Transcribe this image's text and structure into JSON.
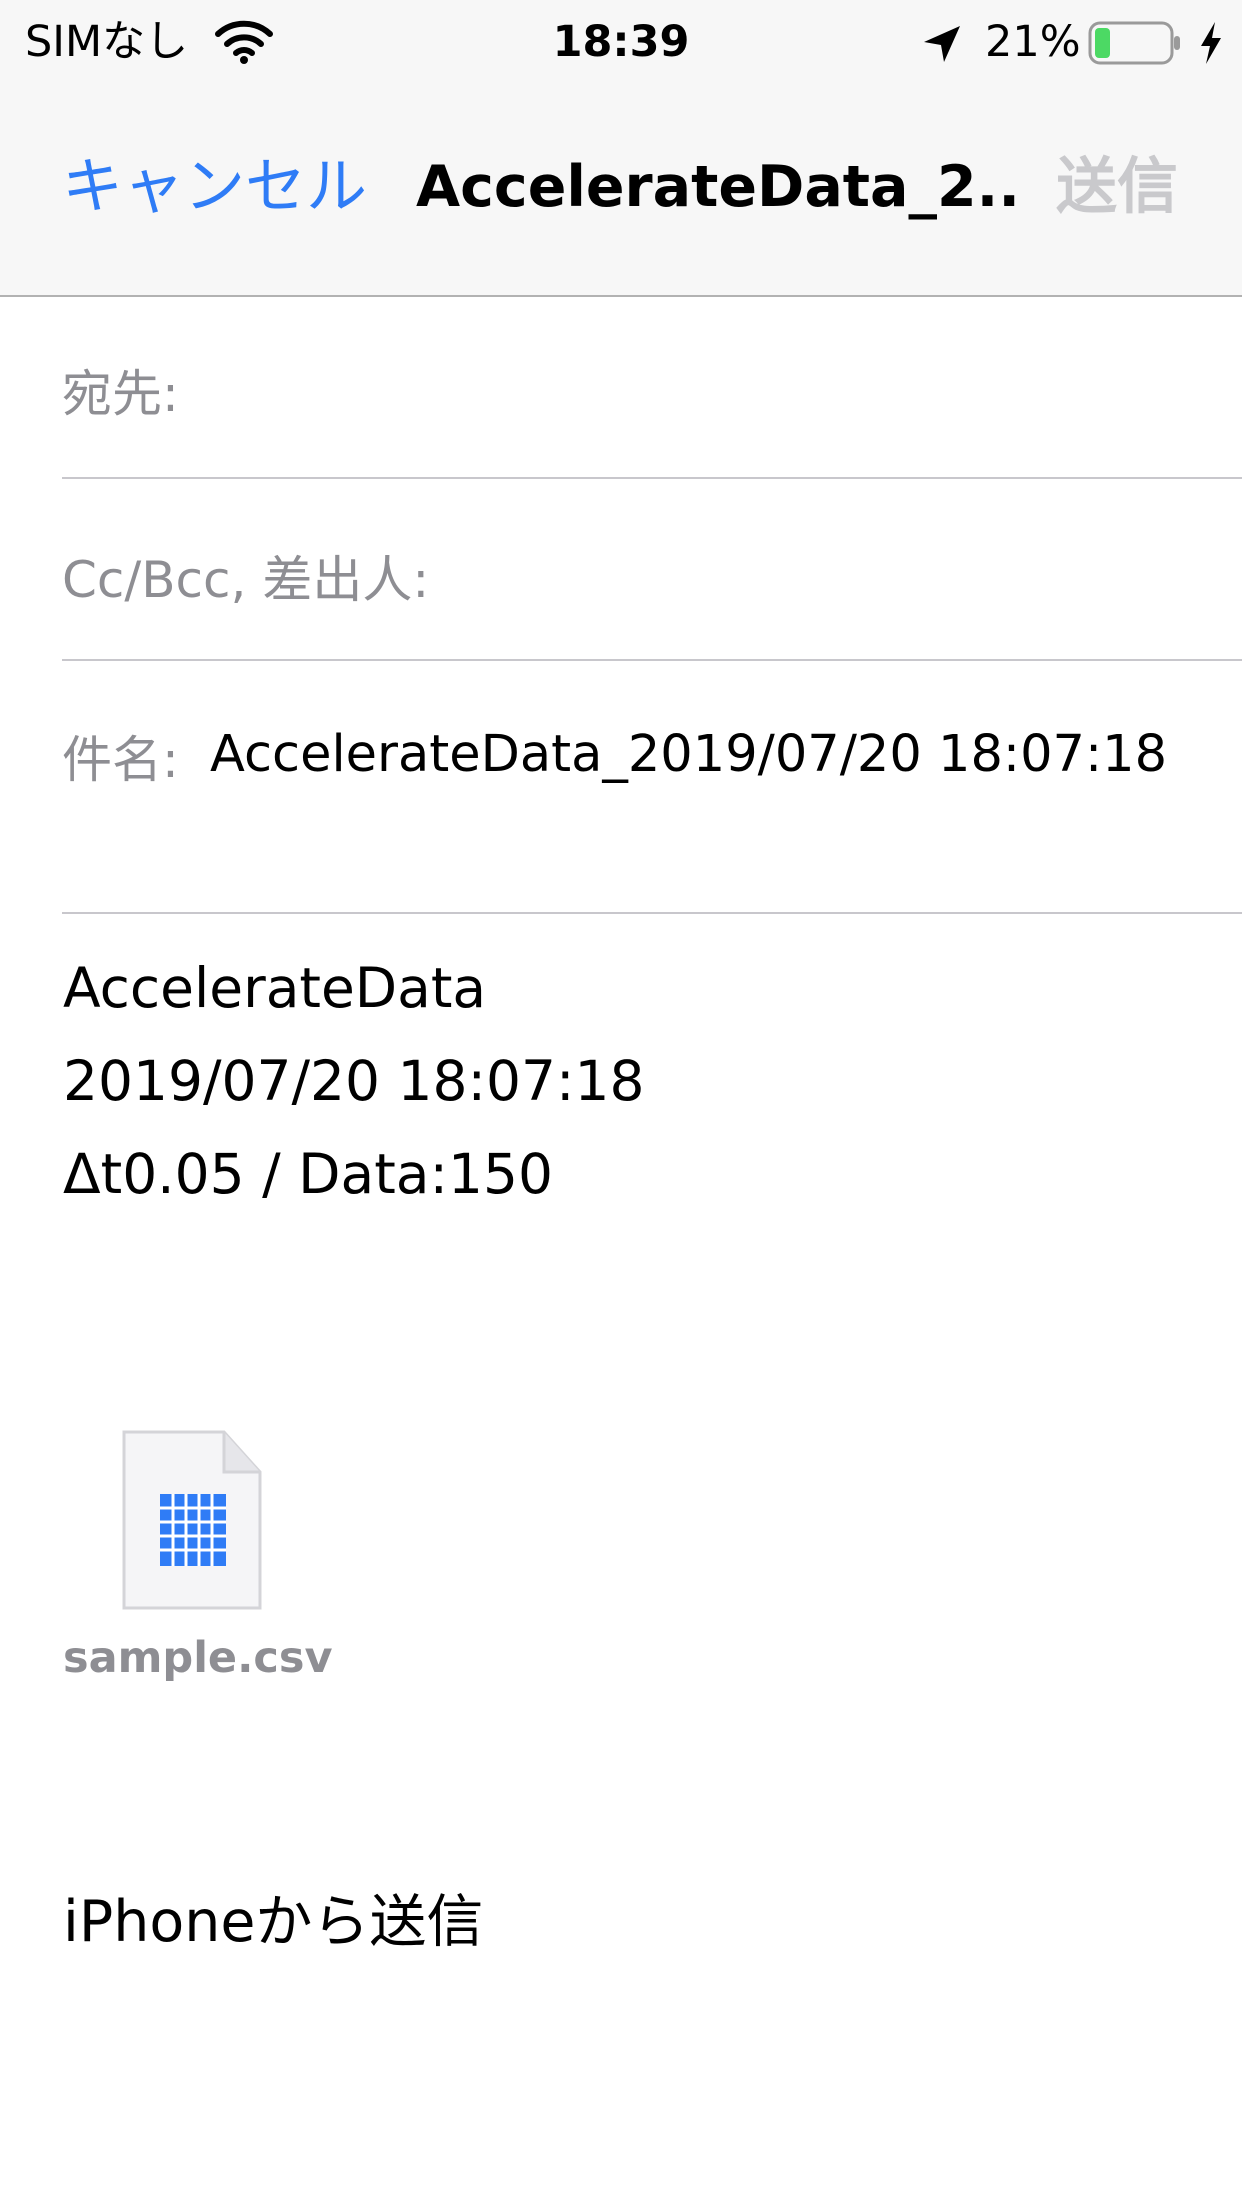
{
  "status_bar": {
    "carrier": "SIMなし",
    "time": "18:39",
    "battery_percent": "21%",
    "battery_level": 0.21,
    "battery_color": "#4cd964"
  },
  "nav": {
    "cancel_label": "キャンセル",
    "title": "AccelerateData_2...",
    "send_label": "送信",
    "accent_color": "#2f7cf6"
  },
  "fields": {
    "to_label": "宛先:",
    "cc_label": "Cc/Bcc, 差出人:",
    "subject_label": "件名:",
    "subject_value": "AccelerateData_2019/07/20 18:07:18"
  },
  "body": {
    "line1": "AccelerateData",
    "line2": "2019/07/20 18:07:18",
    "line3": "Δt0.05 / Data:150",
    "attachment_name": "sample.csv",
    "attachment_icon": "spreadsheet-icon",
    "signature": "iPhoneから送信"
  }
}
